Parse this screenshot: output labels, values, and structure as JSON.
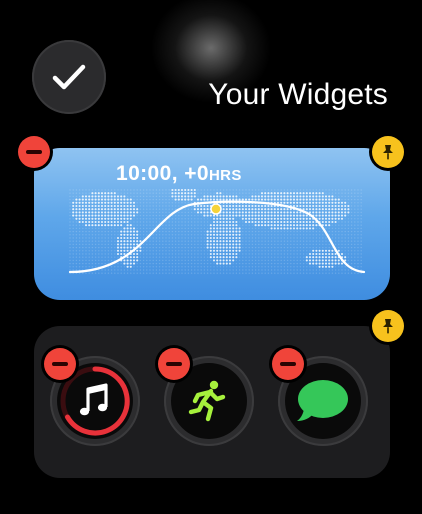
{
  "screen": {
    "title": "Your Widgets"
  },
  "done_button": {
    "icon": "checkmark-icon"
  },
  "world_clock_widget": {
    "time": "10:00,",
    "offset": "+0",
    "offset_unit": "HRS",
    "colors": {
      "sky_top": "#8fc3f1",
      "sky_bottom": "#3f8de0",
      "sun": "#f5d33b"
    }
  },
  "complications": [
    {
      "app": "Music",
      "icon": "music-note-icon",
      "accent": "#e8323a"
    },
    {
      "app": "Workout",
      "icon": "running-figure-icon",
      "accent": "#a6f13c"
    },
    {
      "app": "Messages",
      "icon": "message-bubble-icon",
      "accent": "#35c759"
    }
  ],
  "badges": {
    "remove_color": "#f0443a",
    "pin_color": "#f7c21d"
  }
}
